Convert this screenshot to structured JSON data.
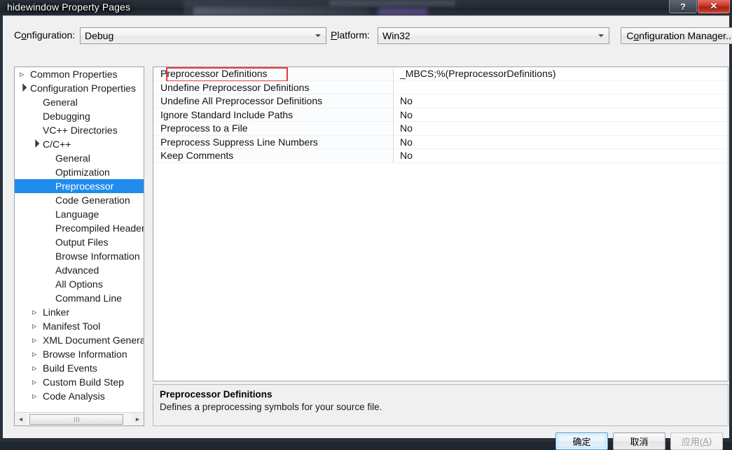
{
  "window": {
    "title": "hidewindow Property Pages",
    "help_button": "?",
    "close_button": "✕"
  },
  "config_bar": {
    "configuration_label_pre": "C",
    "configuration_label_acc": "o",
    "configuration_label_post": "nfiguration:",
    "configuration_value": "Debug",
    "platform_label_pre": "",
    "platform_label_acc": "P",
    "platform_label_post": "latform:",
    "platform_value": "Win32",
    "config_manager_pre": "C",
    "config_manager_acc": "o",
    "config_manager_post": "nfiguration Manager..."
  },
  "tree": {
    "items": [
      {
        "label": "Common Properties",
        "indent": 0,
        "expander": "collapsed",
        "selected": false
      },
      {
        "label": "Configuration Properties",
        "indent": 0,
        "expander": "expanded",
        "selected": false
      },
      {
        "label": "General",
        "indent": 1,
        "expander": "none",
        "selected": false
      },
      {
        "label": "Debugging",
        "indent": 1,
        "expander": "none",
        "selected": false
      },
      {
        "label": "VC++ Directories",
        "indent": 1,
        "expander": "none",
        "selected": false
      },
      {
        "label": "C/C++",
        "indent": 1,
        "expander": "expanded",
        "selected": false
      },
      {
        "label": "General",
        "indent": 2,
        "expander": "none",
        "selected": false
      },
      {
        "label": "Optimization",
        "indent": 2,
        "expander": "none",
        "selected": false
      },
      {
        "label": "Preprocessor",
        "indent": 2,
        "expander": "none",
        "selected": true
      },
      {
        "label": "Code Generation",
        "indent": 2,
        "expander": "none",
        "selected": false
      },
      {
        "label": "Language",
        "indent": 2,
        "expander": "none",
        "selected": false
      },
      {
        "label": "Precompiled Header",
        "indent": 2,
        "expander": "none",
        "selected": false
      },
      {
        "label": "Output Files",
        "indent": 2,
        "expander": "none",
        "selected": false
      },
      {
        "label": "Browse Information",
        "indent": 2,
        "expander": "none",
        "selected": false
      },
      {
        "label": "Advanced",
        "indent": 2,
        "expander": "none",
        "selected": false
      },
      {
        "label": "All Options",
        "indent": 2,
        "expander": "none",
        "selected": false
      },
      {
        "label": "Command Line",
        "indent": 2,
        "expander": "none",
        "selected": false
      },
      {
        "label": "Linker",
        "indent": 1,
        "expander": "collapsed",
        "selected": false
      },
      {
        "label": "Manifest Tool",
        "indent": 1,
        "expander": "collapsed",
        "selected": false
      },
      {
        "label": "XML Document Generat",
        "indent": 1,
        "expander": "collapsed",
        "selected": false
      },
      {
        "label": "Browse Information",
        "indent": 1,
        "expander": "collapsed",
        "selected": false
      },
      {
        "label": "Build Events",
        "indent": 1,
        "expander": "collapsed",
        "selected": false
      },
      {
        "label": "Custom Build Step",
        "indent": 1,
        "expander": "collapsed",
        "selected": false
      },
      {
        "label": "Code Analysis",
        "indent": 1,
        "expander": "collapsed",
        "selected": false
      }
    ],
    "scrollbar": {
      "left_arrow": "◄",
      "right_arrow": "►"
    }
  },
  "property_grid": {
    "rows": [
      {
        "name": "Preprocessor Definitions",
        "value": "_MBCS;%(PreprocessorDefinitions)",
        "annotated": true
      },
      {
        "name": "Undefine Preprocessor Definitions",
        "value": "",
        "annotated": false
      },
      {
        "name": "Undefine All Preprocessor Definitions",
        "value": "No",
        "annotated": false
      },
      {
        "name": "Ignore Standard Include Paths",
        "value": "No",
        "annotated": false
      },
      {
        "name": "Preprocess to a File",
        "value": "No",
        "annotated": false
      },
      {
        "name": "Preprocess Suppress Line Numbers",
        "value": "No",
        "annotated": false
      },
      {
        "name": "Keep Comments",
        "value": "No",
        "annotated": false
      }
    ]
  },
  "description": {
    "title": "Preprocessor Definitions",
    "text": "Defines a preprocessing symbols for your source file."
  },
  "buttons": {
    "ok": "确定",
    "cancel": "取消",
    "apply_pre": "应用(",
    "apply_acc": "A",
    "apply_post": ")"
  },
  "colors": {
    "selection": "#1f8ced",
    "annotation": "#e8393c",
    "dialog_bg": "#f0f0f0"
  }
}
